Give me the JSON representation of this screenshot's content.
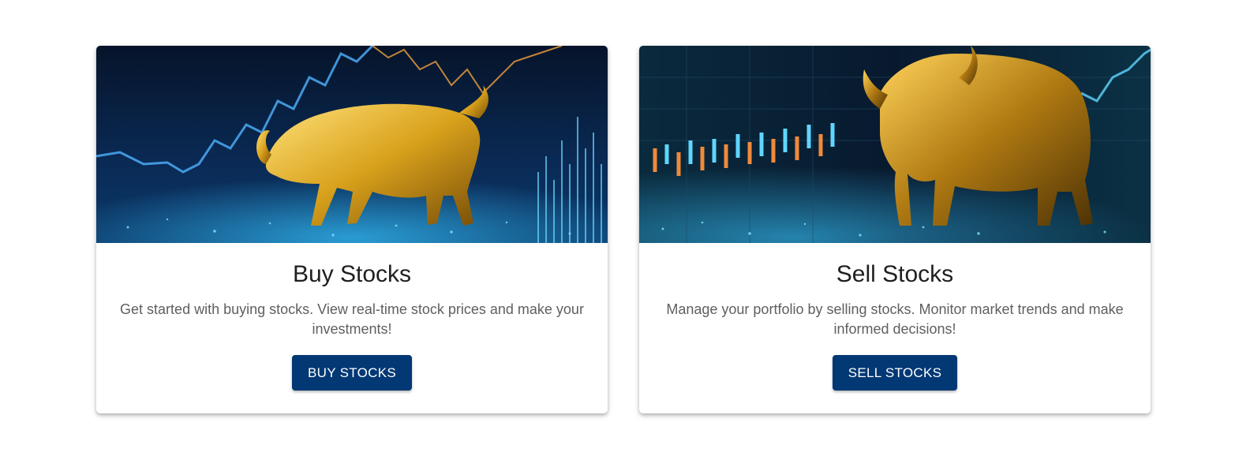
{
  "cards": [
    {
      "title": "Buy Stocks",
      "description": "Get started with buying stocks. View real-time stock prices and make your investments!",
      "button_label": "BUY STOCKS",
      "image_icon": "golden-bull-chart-image"
    },
    {
      "title": "Sell Stocks",
      "description": "Manage your portfolio by selling stocks. Monitor market trends and make informed decisions!",
      "button_label": "SELL STOCKS",
      "image_icon": "golden-bull-chart-image"
    }
  ],
  "colors": {
    "button": "#023874",
    "title": "#1f1f1f",
    "description": "#5f5f5f",
    "image_bg_dark": "#061a33",
    "image_glow": "#37c6ff",
    "bull_gold": "#d9a21c"
  }
}
